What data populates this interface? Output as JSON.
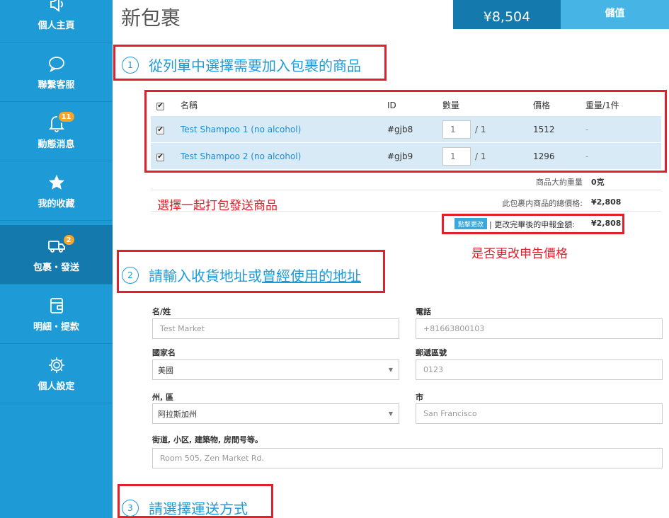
{
  "sidebar": {
    "items": [
      {
        "label": "個人主頁",
        "icon": "megaphone-icon"
      },
      {
        "label": "聯繫客服",
        "icon": "chat-bubble-icon"
      },
      {
        "label": "動態消息",
        "icon": "bell-icon",
        "badge": "11"
      },
      {
        "label": "我的收藏",
        "icon": "star-icon"
      },
      {
        "label": "包裹・發送",
        "icon": "truck-icon",
        "badge": "2",
        "active": true
      },
      {
        "label": "明細・提款",
        "icon": "wallet-icon"
      },
      {
        "label": "個人設定",
        "icon": "gear-icon"
      }
    ],
    "bg_color": "#1e9ad6",
    "active_color": "#1479ad",
    "badge_color": "#f4a52b"
  },
  "header": {
    "title": "新包裹",
    "balance_value": "¥8,504",
    "topup_label": "儲值"
  },
  "step1": {
    "num": "1",
    "title": "從列單中選擇需要加入包裹的商品"
  },
  "table": {
    "columns": {
      "name": "名稱",
      "id": "ID",
      "qty": "數量",
      "price": "價格",
      "weight": "重量/1件"
    },
    "rows": [
      {
        "name": "Test Shampoo 1 (no alcohol)",
        "id": "#gjb8",
        "qty": "1",
        "qty_total": "/ 1",
        "price": "1512",
        "weight": "-"
      },
      {
        "name": "Test Shampoo 2 (no alcohol)",
        "id": "#gjb9",
        "qty": "1",
        "qty_total": "/ 1",
        "price": "1296",
        "weight": "-"
      }
    ]
  },
  "summary": {
    "weight_label": "商品大約重量",
    "weight_value": "0克",
    "total_label": "此包裹内商品的總價格:",
    "total_value": "¥2,808",
    "edit_button": "點擊更改",
    "declared_label": "| 更改完畢後的申報金額:",
    "declared_value": "¥2,808"
  },
  "annotations": {
    "select_note": "選擇一起打包發送商品",
    "price_note": "是否更改申告價格"
  },
  "step2": {
    "num": "2",
    "title_prefix": "請輸入收貨地址或",
    "title_link": "曾經使用的地址"
  },
  "form": {
    "name_label": "名/姓",
    "name_placeholder": "Test Market",
    "phone_label": "電話",
    "phone_placeholder": "+81663800103",
    "country_label": "國家名",
    "country_value": "美國",
    "postal_label": "郵遞區號",
    "postal_placeholder": "0123",
    "state_label": "州, 區",
    "state_value": "阿拉斯加州",
    "city_label": "市",
    "city_placeholder": "San Francisco",
    "street_label": "街道, 小区, 建築物, 房間号等。",
    "street_placeholder": "Room 505, Zen Market Rd."
  },
  "step3": {
    "num": "3",
    "title": "請選擇運送方式"
  },
  "colors": {
    "accent": "#1e9ad6",
    "annotation_red": "#e0202a",
    "row_bg": "#d8eaf6"
  }
}
